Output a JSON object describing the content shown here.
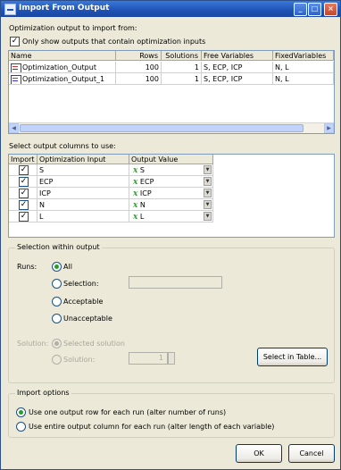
{
  "window": {
    "title": "Import From Output"
  },
  "titlebar": {
    "minimize": "_",
    "maximize": "□",
    "close": "×"
  },
  "outputs": {
    "section_label": "Optimization output to import from:",
    "only_show_checkbox": {
      "checked": true,
      "mark": "✓",
      "label": "Only show outputs that contain optimization inputs"
    },
    "columns": [
      "Name",
      "Rows",
      "Solutions",
      "Free Variables",
      "FixedVariables"
    ],
    "rows": [
      {
        "name": "Optimization_Output",
        "rows": "100",
        "solutions": "1",
        "free": "S, ECP, ICP",
        "fixed": "N, L"
      },
      {
        "name": "Optimization_Output_1",
        "rows": "100",
        "solutions": "1",
        "free": "S, ECP, ICP",
        "fixed": "N, L"
      }
    ],
    "scroll": {
      "left": "◀",
      "right": "▶"
    }
  },
  "columns_select": {
    "section_label": "Select output columns to use:",
    "columns": [
      "Import",
      "Optimization Input",
      "Output Value"
    ],
    "fx_symbol": "x",
    "rows": [
      {
        "checked": true,
        "mark": "✓",
        "input": "S",
        "value": "S"
      },
      {
        "checked": true,
        "mark": "✓",
        "input": "ECP",
        "value": "ECP"
      },
      {
        "checked": true,
        "mark": "✓",
        "input": "ICP",
        "value": "ICP"
      },
      {
        "checked": true,
        "mark": "✓",
        "input": "N",
        "value": "N"
      },
      {
        "checked": true,
        "mark": "✓",
        "input": "L",
        "value": "L"
      }
    ],
    "dropdown_arrow": "▼"
  },
  "selection": {
    "group_title": "Selection within output",
    "runs_label": "Runs:",
    "runs_options": [
      {
        "label": "All",
        "selected": true
      },
      {
        "label": "Selection:",
        "selected": false
      },
      {
        "label": "Acceptable",
        "selected": false
      },
      {
        "label": "Unacceptable",
        "selected": false
      }
    ],
    "solution_label": "Solution:",
    "solution_options": [
      {
        "label": "Selected solution",
        "selected": true
      },
      {
        "label": "Solution:",
        "selected": false
      }
    ],
    "solution_value": "1",
    "select_in_table_button": "Select in Table..."
  },
  "import_options": {
    "group_title": "Import options",
    "options": [
      {
        "label": "Use one output row for each run (alter number of runs)",
        "selected": true
      },
      {
        "label": "Use entire output column for each run (alter length of each variable)",
        "selected": false
      }
    ]
  },
  "footer": {
    "ok": "OK",
    "cancel": "Cancel"
  }
}
